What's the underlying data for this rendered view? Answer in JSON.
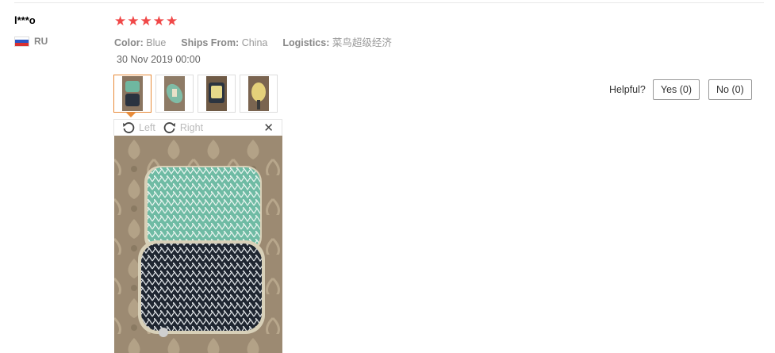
{
  "review": {
    "user": "l***o",
    "country": "RU",
    "rating": 5,
    "attributes": [
      {
        "label": "Color:",
        "value": "Blue"
      },
      {
        "label": "Ships From:",
        "value": "China"
      },
      {
        "label": "Logistics:",
        "value": "菜鸟超级经济"
      }
    ],
    "date": "30 Nov 2019 00:00",
    "thumbnail_count": 4,
    "selected_thumbnail": 1
  },
  "viewer": {
    "rotate_left_label": "Left",
    "rotate_right_label": "Right",
    "close_icon": "close-icon"
  },
  "helpful": {
    "label": "Helpful?",
    "yes_label": "Yes (0)",
    "no_label": "No (0)"
  },
  "colors": {
    "star": "#f04848",
    "selected_border": "#e88b3a",
    "flag": [
      "#ffffff",
      "#2a55c4",
      "#d83030"
    ]
  }
}
